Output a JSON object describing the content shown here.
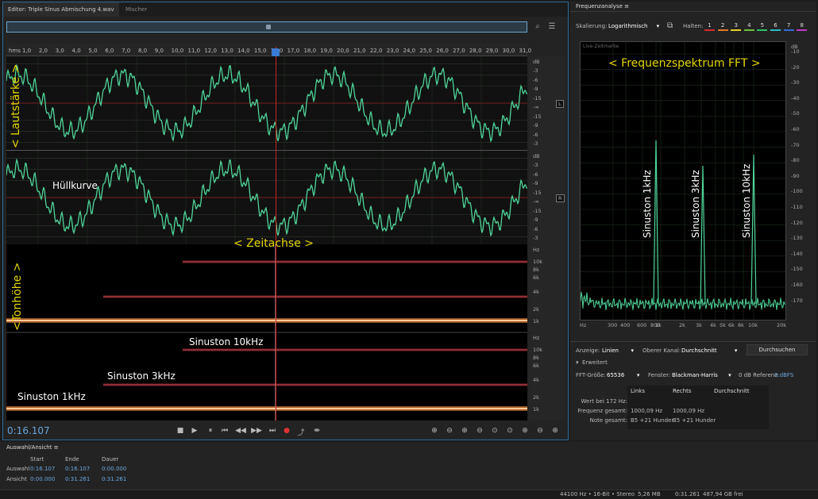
{
  "editor": {
    "tab_editor": "Editor: Triple Sinus Abmischung 4.wav",
    "tab_mixer": "Mischer",
    "ruler_unit": "hms",
    "ruler_ticks": [
      "1,0",
      "2,0",
      "3,0",
      "4,0",
      "5,0",
      "6,0",
      "7,0",
      "8,0",
      "9,0",
      "10,0",
      "11,0",
      "12,0",
      "13,0",
      "14,0",
      "15,0",
      "16,0",
      "17,0",
      "18,0",
      "19,0",
      "20,0",
      "21,0",
      "22,0",
      "23,0",
      "24,0",
      "25,0",
      "26,0",
      "27,0",
      "28,0",
      "29,0",
      "30,0",
      "31,0"
    ],
    "db_unit": "dB",
    "db_ticks": [
      "-3",
      "-6",
      "-9",
      "-15",
      "-∞",
      "-15",
      "-9",
      "-6",
      "-3"
    ],
    "channel_left": "L",
    "channel_right": "R",
    "hz_unit": "Hz",
    "hz_ticks": [
      "10k",
      "8k",
      "6k",
      "4k",
      "2k",
      "1k"
    ],
    "annotation_volume": "< Lautstärke >",
    "annotation_envelope": "Hüllkurve",
    "annotation_time": "< Zeitachse >",
    "annotation_pitch": "<Tonhöhe >",
    "label_10k": "Sinuston 10kHz",
    "label_3k": "Sinuston 3kHz",
    "label_1k": "Sinuston 1kHz",
    "timecode": "0:16.107",
    "transport": [
      "■",
      "▶",
      "⏸",
      "⏮",
      "◀◀",
      "▶▶",
      "⏭",
      "●",
      "⤴",
      "⇼"
    ],
    "zoom_icons": [
      "⊕",
      "⊖",
      "⊕",
      "⊖",
      "⊙",
      "⊙",
      "⊕",
      "⊖",
      "⊕"
    ]
  },
  "freq": {
    "title": "Frequenzanalyse",
    "scaling_label": "Skalierung:",
    "scaling_value": "Logarithmisch",
    "hold_label": "Halten:",
    "holds": [
      {
        "n": "1",
        "color": "#d62b2b"
      },
      {
        "n": "2",
        "color": "#e07b22"
      },
      {
        "n": "3",
        "color": "#e3d22a"
      },
      {
        "n": "4",
        "color": "#6ac23a"
      },
      {
        "n": "5",
        "color": "#2ec26b"
      },
      {
        "n": "6",
        "color": "#2bb9c8"
      },
      {
        "n": "7",
        "color": "#2f6fd6"
      },
      {
        "n": "8",
        "color": "#c236c8"
      }
    ],
    "live_marker": "Live-Zeitmarke",
    "annotation_fft": "< Frequenzspektrum FFT >",
    "peak_1k": "Sinuston 1kHz",
    "peak_3k": "Sinuston 3kHz",
    "peak_10k": "Sinuston 10kHz",
    "y_ticks": [
      "dB",
      "-10",
      "-20",
      "-30",
      "-40",
      "-50",
      "-60",
      "-70",
      "-80",
      "-90",
      "-100",
      "-110",
      "-120",
      "-130",
      "-140",
      "-150",
      "-160",
      "-170"
    ],
    "x_ticks": [
      "Hz",
      "300",
      "400",
      "600",
      "800",
      "1k",
      "2k",
      "3k",
      "4k",
      "5k",
      "6k",
      "8k",
      "10k",
      "20k"
    ],
    "display_label": "Anzeige:",
    "display_value": "Linien",
    "top_channel_label": "Oberer Kanal:",
    "top_channel_value": "Durchschnitt",
    "scan_button": "Durchsuchen",
    "advanced": "Erweitert",
    "fft_label": "FFT-Größe:",
    "fft_value": "65536",
    "window_label": "Fenster:",
    "window_value": "Blackman-Harris",
    "ref_label": "0 dB Referenz:",
    "ref_value": "0 dBFS",
    "table_headers": [
      "Links",
      "Rechts",
      "Durchschnitt"
    ],
    "rows": [
      {
        "label": "Wert bei 172 Hz:",
        "l": "",
        "r": "",
        "a": ""
      },
      {
        "label": "Frequenz gesamt:",
        "l": "1000,09 Hz",
        "r": "1000,09 Hz",
        "a": ""
      },
      {
        "label": "Note gesamt:",
        "l": "B5 +21 Hunder",
        "r": "B5 +21 Hunder",
        "a": ""
      }
    ]
  },
  "selection": {
    "title": "Auswahl/Ansicht",
    "col_start": "Start",
    "col_end": "Ende",
    "col_dur": "Dauer",
    "row_sel": "Auswahl",
    "row_view": "Ansicht",
    "sel_start": "0:16.107",
    "sel_end": "0:16.107",
    "sel_dur": "0:00.000",
    "view_start": "0:00.000",
    "view_end": "0:31.261",
    "view_dur": "0:31.261"
  },
  "status": {
    "format": "44100 Hz • 16-Bit • Stereo",
    "size": "5,26 MB",
    "duration": "0:31.261",
    "free": "487,94 GB frei"
  }
}
